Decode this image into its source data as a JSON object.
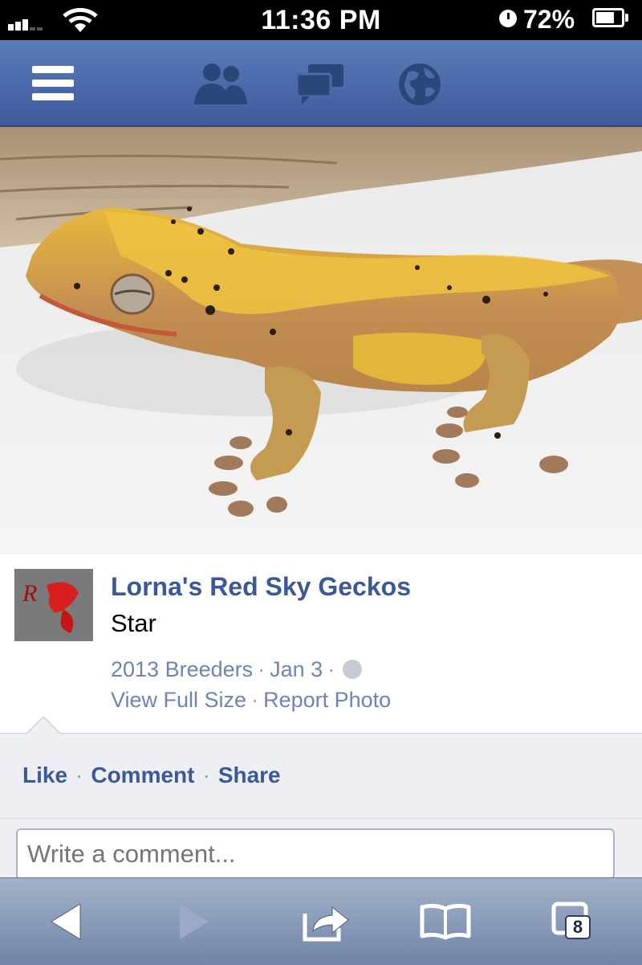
{
  "status_bar": {
    "time": "11:36 PM",
    "battery": "72%",
    "battery_level": 0.72,
    "icons": [
      "signal-icon",
      "wifi-icon",
      "clock-icon",
      "battery-icon"
    ]
  },
  "fb_header": {
    "icons": [
      "menu-icon",
      "friends-icon",
      "messages-icon",
      "notifications-globe-icon"
    ],
    "accent": "#3b5998"
  },
  "photo": {
    "subject": "crested-gecko-photo"
  },
  "post": {
    "page_name": "Lorna's Red Sky Geckos",
    "caption": "Star",
    "album": "2013 Breeders",
    "date": "Jan 3",
    "view_full_size": "View Full Size",
    "report_photo": "Report Photo"
  },
  "actions": {
    "like": "Like",
    "comment": "Comment",
    "share": "Share"
  },
  "comment": {
    "placeholder": "Write a comment..."
  },
  "toolbar": {
    "tab_count": "8",
    "icons": [
      "back-icon",
      "forward-icon",
      "share-icon",
      "bookmarks-icon",
      "tabs-icon"
    ]
  }
}
